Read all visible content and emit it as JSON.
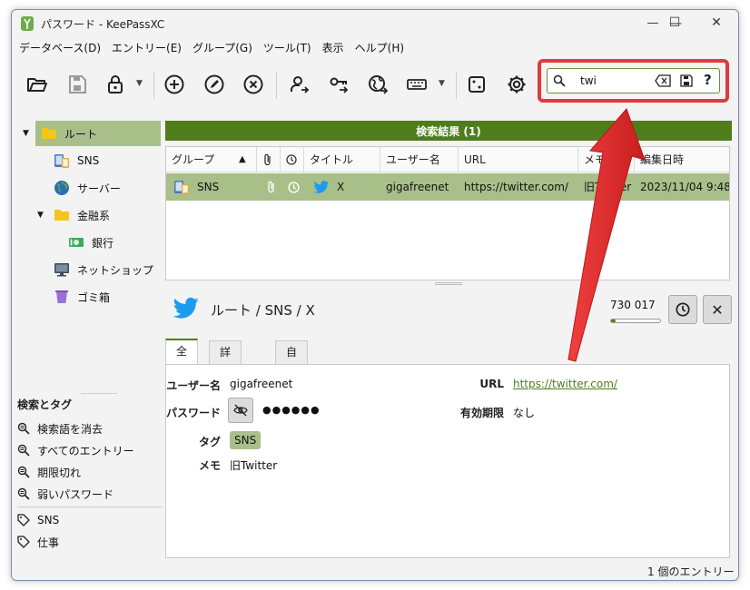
{
  "window": {
    "title": "パスワード - KeePassXC",
    "minimize": "—",
    "maximize": "☐",
    "close": "✕"
  },
  "menu": [
    "データベース(D)",
    "エントリー(E)",
    "グループ(G)",
    "ツール(T)",
    "表示",
    "ヘルプ(H)"
  ],
  "search": {
    "value": "twi",
    "help": "?"
  },
  "tree": {
    "items": [
      {
        "label": "ルート",
        "icon": "folder-icon"
      },
      {
        "label": "SNS",
        "icon": "devices-icon"
      },
      {
        "label": "サーバー",
        "icon": "globe-icon"
      },
      {
        "label": "金融系",
        "icon": "folder-icon"
      },
      {
        "label": "銀行",
        "icon": "money-icon"
      },
      {
        "label": "ネットショップ",
        "icon": "monitor-icon"
      },
      {
        "label": "ゴミ箱",
        "icon": "trash-icon"
      }
    ]
  },
  "tags_panel": {
    "header": "検索とタグ",
    "searches": [
      "検索語を消去",
      "すべてのエントリー",
      "期限切れ",
      "弱いパスワード"
    ],
    "tags": [
      "SNS",
      "仕事"
    ]
  },
  "results": {
    "header": "検索結果 (1)",
    "columns": {
      "group": "グループ",
      "sort": "▲",
      "title": "タイトル",
      "username": "ユーザー名",
      "url": "URL",
      "notes": "メモ",
      "modified": "編集日時"
    },
    "rows": [
      {
        "group": "SNS",
        "title": "X",
        "username": "gigafreenet",
        "url": "https://twitter.com/",
        "notes": "旧Twitter",
        "modified": "2023/11/04 9:48"
      }
    ]
  },
  "details": {
    "path": "ルート / SNS / X",
    "totp": "730 017",
    "totp_remaining": 0.1,
    "close": "✕",
    "tabs": [
      "全般",
      "詳細設定",
      "自動入力"
    ],
    "labels": {
      "username": "ユーザー名",
      "password": "パスワード",
      "tags": "タグ",
      "notes": "メモ",
      "url": "URL",
      "expires": "有効期限"
    },
    "values": {
      "username": "gigafreenet",
      "password": "●●●●●●",
      "tag": "SNS",
      "notes": "旧Twitter",
      "url": "https://twitter.com/",
      "expires": "なし"
    }
  },
  "status": "1 個のエントリー",
  "colors": {
    "accent_green": "#4f7d1c",
    "selection": "#a9bf8a",
    "highlight_red": "#e23a3a"
  }
}
